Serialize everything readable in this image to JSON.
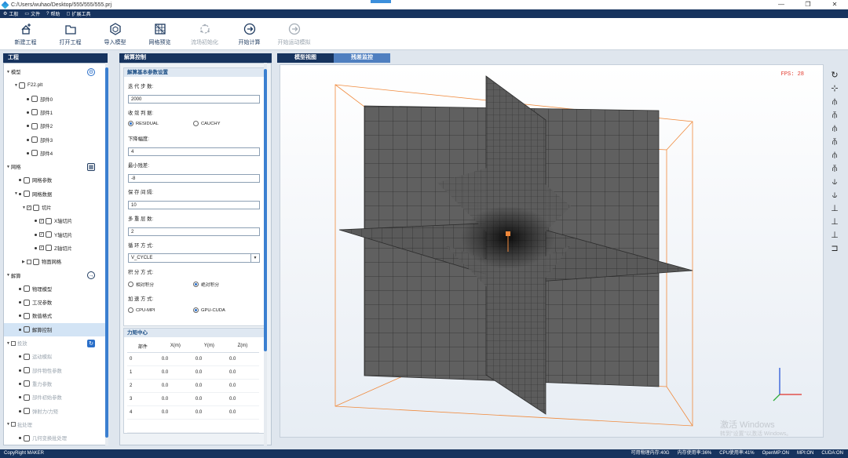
{
  "window": {
    "title_path": "C:/Users/wuhao/Desktop/555/555/555.prj",
    "controls": [
      "—",
      "❐",
      "✕"
    ]
  },
  "menu": [
    {
      "icon": "gear-icon",
      "label": "工般"
    },
    {
      "icon": "folder-icon",
      "label": "文件"
    },
    {
      "icon": "help-icon",
      "label": "帮助"
    },
    {
      "icon": "window-icon",
      "label": "扩展工具"
    }
  ],
  "toolbar": [
    {
      "label": "新建工程",
      "icon": "new-project-icon",
      "enabled": true
    },
    {
      "label": "打开工程",
      "icon": "open-project-icon",
      "enabled": true
    },
    {
      "label": "导入模型",
      "icon": "import-model-icon",
      "enabled": true
    },
    {
      "label": "网格预览",
      "icon": "mesh-preview-icon",
      "enabled": true
    },
    {
      "label": "流场初始化",
      "icon": "flow-init-icon",
      "enabled": false
    },
    {
      "label": "开始计算",
      "icon": "start-compute-icon",
      "enabled": true
    },
    {
      "label": "开始运动模拟",
      "icon": "start-motion-icon",
      "enabled": false
    }
  ],
  "left_panel": {
    "title": "工程",
    "tree": [
      {
        "label": "模型",
        "level": 0,
        "kind": "section",
        "caret": "▼"
      },
      {
        "label": "F22.plt",
        "level": 1,
        "kind": "file",
        "caret": "▼"
      },
      {
        "label": "部件0",
        "level": 2,
        "kind": "part"
      },
      {
        "label": "部件1",
        "level": 2,
        "kind": "part"
      },
      {
        "label": "部件2",
        "level": 2,
        "kind": "part"
      },
      {
        "label": "部件3",
        "level": 2,
        "kind": "part"
      },
      {
        "label": "部件4",
        "level": 2,
        "kind": "part"
      },
      {
        "label": "网格",
        "level": 0,
        "kind": "section",
        "caret": "▼"
      },
      {
        "label": "网格参数",
        "level": 1,
        "kind": "item"
      },
      {
        "label": "网格数据",
        "level": 1,
        "kind": "item",
        "caret": "▼"
      },
      {
        "label": "切片",
        "level": 2,
        "kind": "check",
        "caret": "▼",
        "checked": true
      },
      {
        "label": "X轴切片",
        "level": 3,
        "kind": "check",
        "checked": true
      },
      {
        "label": "Y轴切片",
        "level": 3,
        "kind": "check",
        "checked": true
      },
      {
        "label": "Z轴切片",
        "level": 3,
        "kind": "check",
        "checked": true
      },
      {
        "label": "物面网格",
        "level": 2,
        "kind": "check",
        "caret": "▶",
        "checked": false
      },
      {
        "label": "解算",
        "level": 0,
        "kind": "section",
        "caret": "▼"
      },
      {
        "label": "物理模型",
        "level": 1,
        "kind": "item"
      },
      {
        "label": "工况参数",
        "level": 1,
        "kind": "item"
      },
      {
        "label": "数值格式",
        "level": 1,
        "kind": "item"
      },
      {
        "label": "解算控制",
        "level": 1,
        "kind": "item",
        "selected": true
      },
      {
        "label": "投放",
        "level": 0,
        "kind": "section-check",
        "caret": "▼",
        "dim": true
      },
      {
        "label": "运动模拟",
        "level": 1,
        "kind": "item",
        "dim": true
      },
      {
        "label": "部件物性参数",
        "level": 1,
        "kind": "item",
        "dim": true
      },
      {
        "label": "重力参数",
        "level": 1,
        "kind": "item",
        "dim": true
      },
      {
        "label": "部件初始参数",
        "level": 1,
        "kind": "item",
        "dim": true
      },
      {
        "label": "弹射力/力矩",
        "level": 1,
        "kind": "item",
        "dim": true
      },
      {
        "label": "批处理",
        "level": 0,
        "kind": "section-check",
        "caret": "▼",
        "dim": true
      },
      {
        "label": "几何变换批处理",
        "level": 1,
        "kind": "item",
        "dim": true
      }
    ]
  },
  "solver_panel": {
    "title": "解算控制",
    "basic_group_title": "解算基本参数设置",
    "iterations_label": "迭 代 步 数:",
    "iterations_value": "2000",
    "convergence_label": "收 敛 判 据:",
    "convergence_options": [
      "RESIDUAL",
      "CAUCHY"
    ],
    "convergence_selected": "RESIDUAL",
    "drop_label": "下降幅度:",
    "drop_value": "4",
    "min_residual_label": "最小残差:",
    "min_residual_value": "-8",
    "save_interval_label": "保 存 间 隔:",
    "save_interval_value": "10",
    "multigrid_label": "多 重 层 数:",
    "multigrid_value": "2",
    "cycle_label": "循 环 方 式:",
    "cycle_value": "V_CYCLE",
    "integration_label": "积 分 方 式:",
    "integration_options": [
      "相对积分",
      "绝对积分"
    ],
    "integration_selected": "绝对积分",
    "accel_label": "加 速 方 式:",
    "accel_options": [
      "CPU-MPI",
      "GPU-CUDA"
    ],
    "accel_selected": "GPU-CUDA",
    "moment_group_title": "力矩中心",
    "moment_columns": [
      "部件",
      "X(m)",
      "Y(m)",
      "Z(m)"
    ],
    "moment_rows": [
      [
        "0",
        "0.0",
        "0.0",
        "0.0"
      ],
      [
        "1",
        "0.0",
        "0.0",
        "0.0"
      ],
      [
        "2",
        "0.0",
        "0.0",
        "0.0"
      ],
      [
        "3",
        "0.0",
        "0.0",
        "0.0"
      ],
      [
        "4",
        "0.0",
        "0.0",
        "0.0"
      ]
    ]
  },
  "viewport": {
    "tabs": [
      "模型视图",
      "残差监控"
    ],
    "active_tab": "模型视图",
    "fps_text": "FPS: 28",
    "activation_title": "激活 Windows",
    "activation_sub": "转到\"设置\"以激活 Windows。",
    "axis_colors": {
      "x": "#e0302a",
      "y": "#2fae3a",
      "z": "#2a58d8"
    },
    "box_color": "#f08a3c",
    "mesh_fill": "#5c5c5c",
    "mesh_line": "#2d2d2d"
  },
  "side_tools": [
    "rotate-icon",
    "view-xy-icon",
    "view-yz-icon",
    "view-zx-icon",
    "view-front-icon",
    "view-back-icon",
    "view-left-icon",
    "view-right-icon",
    "view-top-icon",
    "view-bottom-icon",
    "view-iso1-icon",
    "view-iso2-icon",
    "view-iso3-icon",
    "view-iso4-icon"
  ],
  "statusbar": {
    "copyright": "CopyRight MAKER",
    "stats": [
      "可用物理内存:40G",
      "内存使用率:36%",
      "CPU使用率:41%",
      "OpenMP:ON",
      "MPI:ON",
      "CUDA:ON"
    ]
  }
}
